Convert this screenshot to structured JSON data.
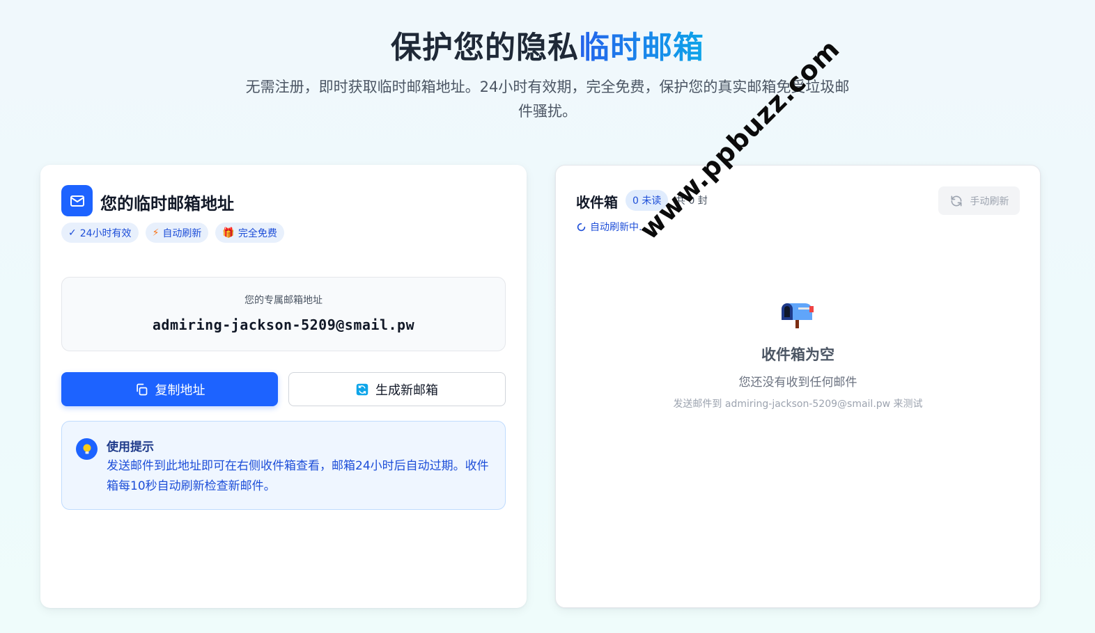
{
  "hero": {
    "title_main": "保护您的隐私",
    "title_accent": "临时邮箱",
    "subtitle": "无需注册，即时获取临时邮箱地址。24小时有效期，完全免费，保护您的真实邮箱免受垃圾邮件骚扰。"
  },
  "left_card": {
    "title": "您的临时邮箱地址",
    "pills": [
      {
        "icon": "✓",
        "label": "24小时有效"
      },
      {
        "icon": "⚡",
        "label": "自动刷新"
      },
      {
        "icon": "🎁",
        "label": "完全免费"
      }
    ],
    "address_label": "您的专属邮箱地址",
    "address": "admiring-jackson-5209@smail.pw",
    "copy_button": "复制地址",
    "new_button": "生成新邮箱",
    "tip_title": "使用提示",
    "tip_text": "发送邮件到此地址即可在右侧收件箱查看，邮箱24小时后自动过期。收件箱每10秒自动刷新检查新邮件。"
  },
  "right_card": {
    "title": "收件箱",
    "unread_badge": "0 未读",
    "total_count": "共 0 封",
    "auto_status": "自动刷新中...",
    "refresh_button": "手动刷新",
    "empty_title": "收件箱为空",
    "empty_subtitle": "您还没有收到任何邮件",
    "empty_hint": "发送邮件到 admiring-jackson-5209@smail.pw 来测试"
  },
  "watermark": "www.ppbuzz.com",
  "colors": {
    "primary": "#1d63ff",
    "accent_gradient_start": "#2563eb",
    "accent_gradient_end": "#0ea5e9",
    "tip_background": "#eff6ff"
  }
}
